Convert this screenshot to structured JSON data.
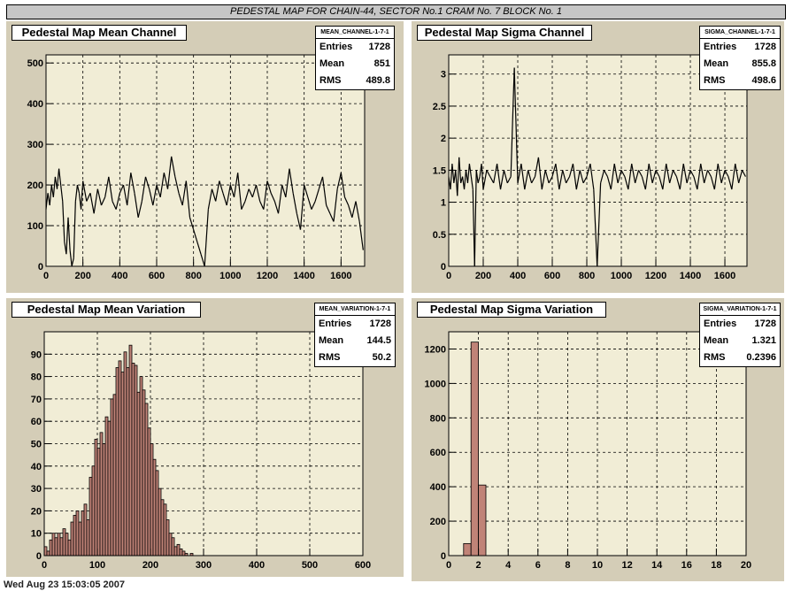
{
  "page_title": "PEDESTAL MAP FOR CHAIN-44, SECTOR No.1 CRAM No. 7 BLOCK No. 1",
  "footer": "Wed Aug 23 15:03:05 2007",
  "colors": {
    "pad": "#d4cdb7",
    "frame": "#f1edd6",
    "fill": "#c08377",
    "line": "#000000",
    "grid": "#000000"
  },
  "chart_data": [
    {
      "type": "line",
      "title": "Pedestal Map Mean Channel",
      "stats": {
        "name": "MEAN_CHANNEL-1-7-1",
        "entries_label": "Entries",
        "entries": "1728",
        "mean_label": "Mean",
        "mean": "851",
        "rms_label": "RMS",
        "rms": "489.8"
      },
      "xlim": [
        0,
        1728
      ],
      "ylim": [
        0,
        520
      ],
      "xticks": [
        0,
        200,
        400,
        600,
        800,
        1000,
        1200,
        1400,
        1600
      ],
      "yticks": [
        0,
        100,
        200,
        300,
        400,
        500
      ],
      "x": [
        0,
        10,
        20,
        30,
        40,
        50,
        60,
        70,
        80,
        90,
        100,
        110,
        120,
        130,
        140,
        150,
        160,
        170,
        180,
        190,
        200,
        220,
        240,
        260,
        280,
        300,
        320,
        340,
        360,
        380,
        400,
        420,
        440,
        460,
        480,
        500,
        520,
        540,
        560,
        580,
        600,
        620,
        640,
        660,
        680,
        700,
        720,
        740,
        760,
        780,
        800,
        820,
        840,
        860,
        880,
        900,
        920,
        940,
        960,
        980,
        1000,
        1020,
        1040,
        1060,
        1080,
        1100,
        1120,
        1140,
        1160,
        1180,
        1200,
        1220,
        1240,
        1260,
        1280,
        1300,
        1320,
        1340,
        1360,
        1380,
        1400,
        1420,
        1440,
        1460,
        1480,
        1500,
        1520,
        1540,
        1560,
        1580,
        1600,
        1620,
        1640,
        1660,
        1680,
        1700,
        1720
      ],
      "y": [
        140,
        180,
        150,
        200,
        170,
        220,
        190,
        240,
        200,
        160,
        60,
        30,
        120,
        40,
        0,
        20,
        160,
        200,
        180,
        140,
        210,
        160,
        180,
        130,
        190,
        150,
        170,
        220,
        160,
        140,
        180,
        200,
        150,
        230,
        180,
        120,
        160,
        220,
        190,
        150,
        200,
        170,
        230,
        190,
        270,
        220,
        180,
        150,
        210,
        120,
        90,
        60,
        30,
        0,
        140,
        190,
        160,
        210,
        180,
        150,
        200,
        170,
        230,
        140,
        160,
        190,
        170,
        200,
        160,
        140,
        210,
        180,
        160,
        130,
        200,
        170,
        240,
        180,
        130,
        90,
        200,
        170,
        140,
        160,
        190,
        220,
        150,
        130,
        110,
        190,
        230,
        170,
        150,
        120,
        160,
        110,
        40
      ]
    },
    {
      "type": "line",
      "title": "Pedestal Map Sigma Channel",
      "stats": {
        "name": "SIGMA_CHANNEL-1-7-1",
        "entries_label": "Entries",
        "entries": "1728",
        "mean_label": "Mean",
        "mean": "855.8",
        "rms_label": "RMS",
        "rms": "498.6"
      },
      "xlim": [
        0,
        1728
      ],
      "ylim": [
        0,
        3.3
      ],
      "xticks": [
        0,
        200,
        400,
        600,
        800,
        1000,
        1200,
        1400,
        1600
      ],
      "yticks": [
        0,
        0.5,
        1,
        1.5,
        2,
        2.5,
        3
      ],
      "x": [
        0,
        10,
        20,
        30,
        40,
        50,
        60,
        70,
        80,
        90,
        100,
        110,
        120,
        130,
        140,
        150,
        160,
        170,
        180,
        190,
        200,
        220,
        240,
        260,
        280,
        300,
        320,
        340,
        360,
        380,
        400,
        420,
        440,
        460,
        480,
        500,
        520,
        540,
        560,
        580,
        600,
        620,
        640,
        660,
        680,
        700,
        720,
        740,
        760,
        780,
        800,
        820,
        840,
        860,
        880,
        900,
        920,
        940,
        960,
        980,
        1000,
        1020,
        1040,
        1060,
        1080,
        1100,
        1120,
        1140,
        1160,
        1180,
        1200,
        1220,
        1240,
        1260,
        1280,
        1300,
        1320,
        1340,
        1360,
        1380,
        1400,
        1420,
        1440,
        1460,
        1480,
        1500,
        1520,
        1540,
        1560,
        1580,
        1600,
        1620,
        1640,
        1660,
        1680,
        1700,
        1720
      ],
      "y": [
        1.4,
        1.2,
        1.6,
        1.3,
        1.5,
        1.1,
        1.7,
        1.3,
        1.4,
        1.2,
        1.5,
        1.3,
        1.6,
        1.4,
        1.2,
        0,
        1.5,
        1.3,
        1.4,
        1.6,
        1.2,
        1.5,
        1.4,
        1.3,
        1.6,
        1.2,
        1.5,
        1.3,
        1.4,
        3.1,
        1.3,
        1.6,
        1.2,
        1.5,
        1.3,
        1.4,
        1.7,
        1.2,
        1.5,
        1.3,
        1.4,
        1.6,
        1.2,
        1.5,
        1.3,
        1.4,
        1.6,
        1.2,
        1.5,
        1.3,
        1.4,
        1.6,
        1.2,
        0,
        1.3,
        1.5,
        1.4,
        1.2,
        1.6,
        1.3,
        1.5,
        1.4,
        1.2,
        1.6,
        1.3,
        1.5,
        1.4,
        1.2,
        1.6,
        1.3,
        1.5,
        1.4,
        1.2,
        1.6,
        1.3,
        1.5,
        1.4,
        1.2,
        1.6,
        1.3,
        1.5,
        1.4,
        1.2,
        1.6,
        1.3,
        1.5,
        1.4,
        1.2,
        1.6,
        1.3,
        1.5,
        1.4,
        1.2,
        1.6,
        1.3,
        1.5,
        1.4
      ]
    },
    {
      "type": "bar",
      "title": "Pedestal Map Mean Variation",
      "stats": {
        "name": "MEAN_VARIATION-1-7-1",
        "entries_label": "Entries",
        "entries": "1728",
        "mean_label": "Mean",
        "mean": "144.5",
        "rms_label": "RMS",
        "rms": "50.2"
      },
      "xlim": [
        0,
        600
      ],
      "ylim": [
        0,
        100
      ],
      "xticks": [
        0,
        100,
        200,
        300,
        400,
        500,
        600
      ],
      "yticks": [
        0,
        10,
        20,
        30,
        40,
        50,
        60,
        70,
        80,
        90
      ],
      "bin_width": 5,
      "bin_start": 0,
      "values": [
        4,
        2,
        7,
        10,
        8,
        10,
        8,
        12,
        10,
        7,
        15,
        18,
        20,
        15,
        20,
        23,
        16,
        35,
        40,
        52,
        48,
        55,
        50,
        62,
        60,
        70,
        72,
        84,
        87,
        82,
        91,
        84,
        94,
        86,
        85,
        73,
        80,
        74,
        68,
        57,
        50,
        43,
        38,
        30,
        25,
        23,
        16,
        10,
        8,
        4,
        5,
        3,
        2,
        1,
        0,
        1
      ]
    },
    {
      "type": "bar",
      "title": "Pedestal Map Sigma Variation",
      "stats": {
        "name": "SIGMA_VARIATION-1-7-1",
        "entries_label": "Entries",
        "entries": "1728",
        "mean_label": "Mean",
        "mean": "1.321",
        "rms_label": "RMS",
        "rms": "0.2396"
      },
      "xlim": [
        0,
        20
      ],
      "ylim": [
        0,
        1300
      ],
      "xticks": [
        0,
        2,
        4,
        6,
        8,
        10,
        12,
        14,
        16,
        18,
        20
      ],
      "yticks": [
        0,
        200,
        400,
        600,
        800,
        1000,
        1200
      ],
      "bin_width": 0.5,
      "bin_start": 0,
      "values": [
        0,
        0,
        70,
        1240,
        410
      ]
    }
  ]
}
